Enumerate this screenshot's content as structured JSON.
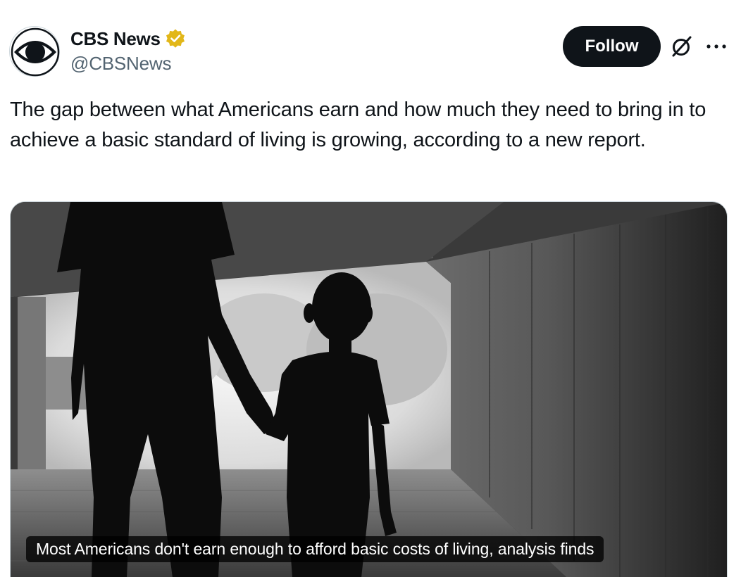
{
  "author": {
    "display_name": "CBS News",
    "handle": "@CBSNews",
    "avatar_icon": "cbs-eye-logo",
    "verified_icon": "gold-verified-badge-icon",
    "verified_color": "#e2b719"
  },
  "actions": {
    "follow_label": "Follow",
    "grok_icon": "grok-icon",
    "more_icon": "more-horizontal-icon"
  },
  "tweet": {
    "text": "The gap between what Americans earn and how much they need to bring in to achieve a basic standard of living is growing, according to a new report."
  },
  "media": {
    "image_subject": "silhouette of adult and child holding hands in a tunnel",
    "caption": "Most Americans don't earn enough to afford basic costs of living, analysis finds"
  },
  "colors": {
    "text_primary": "#0f1419",
    "text_secondary": "#536471",
    "follow_button_bg": "#0f1419",
    "border": "#cfd9de"
  }
}
